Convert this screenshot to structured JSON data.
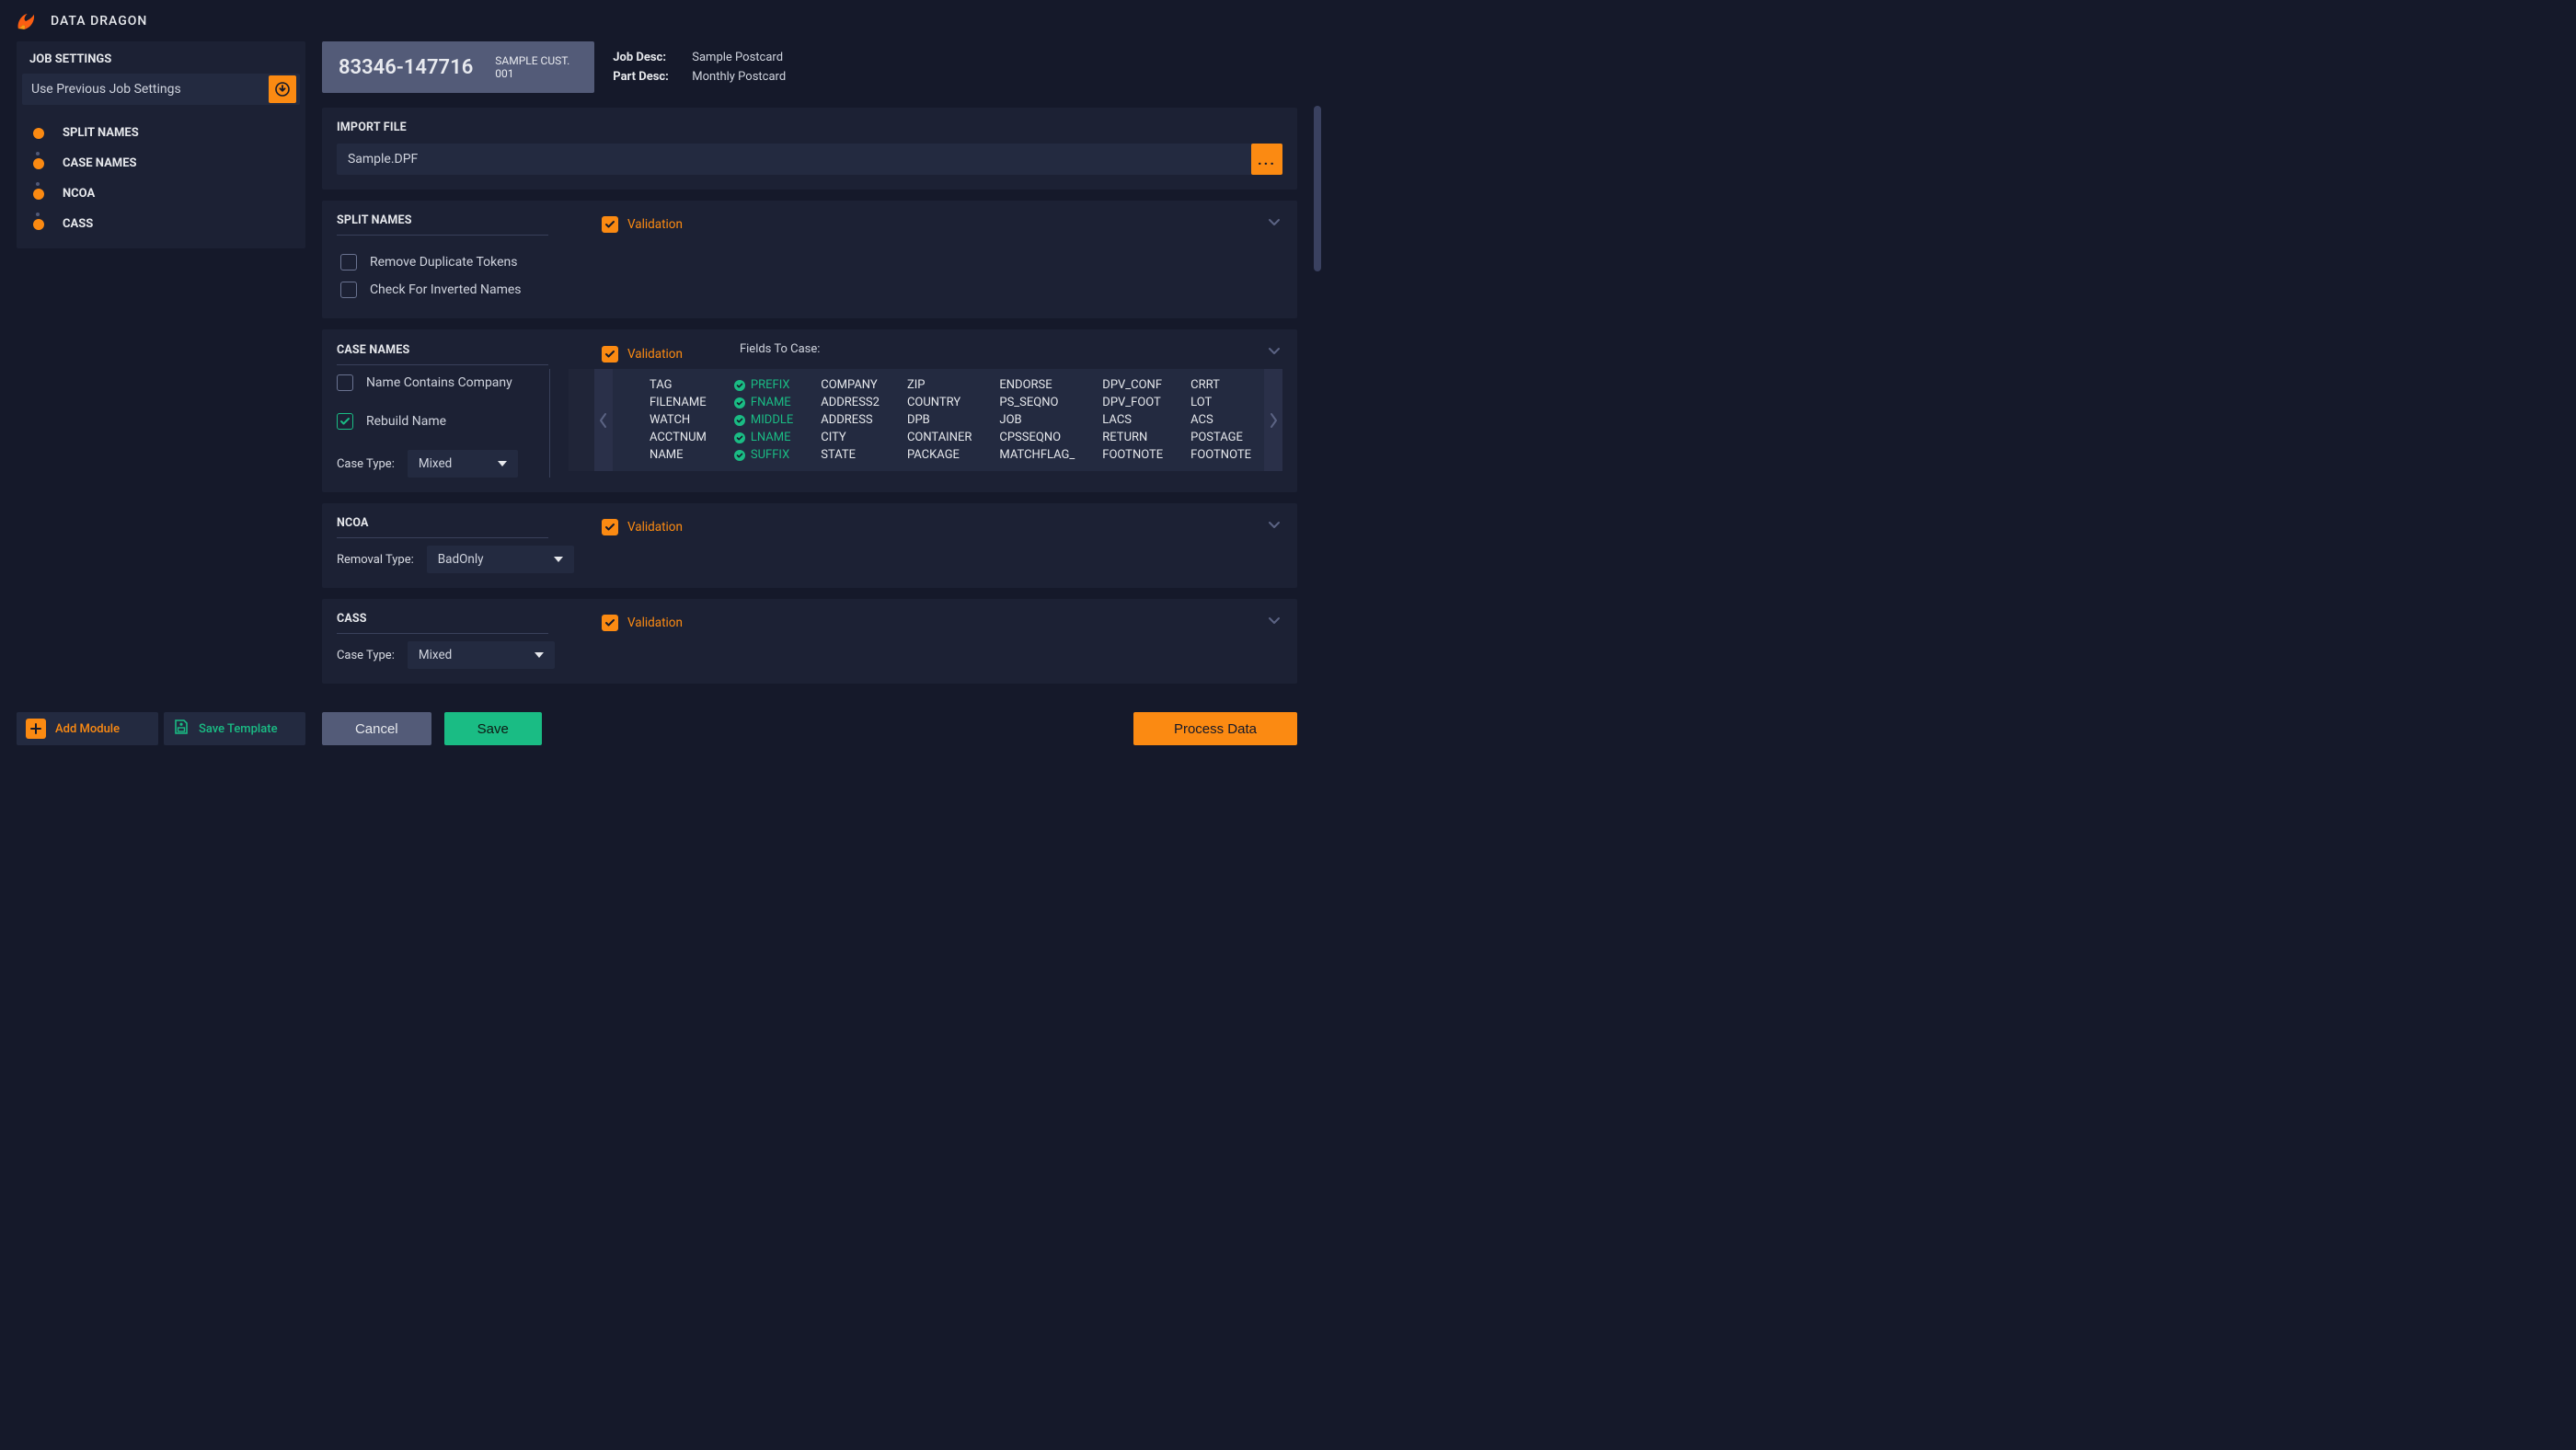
{
  "app": {
    "title": "DATA DRAGON"
  },
  "sidebar": {
    "header": "JOB SETTINGS",
    "prev_settings_label": "Use Previous Job Settings",
    "modules": [
      {
        "label": "SPLIT NAMES"
      },
      {
        "label": "CASE NAMES"
      },
      {
        "label": "NCOA"
      },
      {
        "label": "CASS"
      }
    ],
    "add_module_label": "Add Module",
    "save_template_label": "Save Template"
  },
  "job": {
    "id": "83346-147716",
    "customer": "SAMPLE CUST. 001",
    "desc_key": "Job Desc:",
    "desc_val": "Sample Postcard",
    "part_key": "Part Desc:",
    "part_val": "Monthly Postcard"
  },
  "import": {
    "title": "IMPORT FILE",
    "filename": "Sample.DPF",
    "browse_label": "..."
  },
  "split_names": {
    "title": "SPLIT NAMES",
    "validation_label": "Validation",
    "remove_dup_label": "Remove Duplicate Tokens",
    "check_inverted_label": "Check For Inverted Names"
  },
  "case_names": {
    "title": "CASE NAMES",
    "validation_label": "Validation",
    "contains_company_label": "Name Contains Company",
    "rebuild_name_label": "Rebuild Name",
    "case_type_key": "Case Type:",
    "case_type_val": "Mixed",
    "fields_label": "Fields To Case:",
    "columns": [
      [
        "TAG",
        "FILENAME",
        "WATCH",
        "ACCTNUM",
        "NAME"
      ],
      [
        "PREFIX",
        "FNAME",
        "MIDDLE",
        "LNAME",
        "SUFFIX"
      ],
      [
        "COMPANY",
        "ADDRESS2",
        "ADDRESS",
        "CITY",
        "STATE"
      ],
      [
        "ZIP",
        "COUNTRY",
        "DPB",
        "CONTAINER",
        "PACKAGE"
      ],
      [
        "ENDORSE",
        "PS_SEQNO",
        "JOB",
        "CPSSEQNO",
        "MATCHFLAG_"
      ],
      [
        "DPV_CONF",
        "DPV_FOOT",
        "LACS",
        "RETURN",
        "FOOTNOTE"
      ],
      [
        "CRRT",
        "LOT",
        "ACS",
        "POSTAGE",
        "FOOTNOTE"
      ]
    ],
    "selected_col_index": 1
  },
  "ncoa": {
    "title": "NCOA",
    "validation_label": "Validation",
    "removal_type_key": "Removal Type:",
    "removal_type_val": "BadOnly"
  },
  "cass": {
    "title": "CASS",
    "validation_label": "Validation",
    "case_type_key": "Case Type:",
    "case_type_val": "Mixed"
  },
  "footer": {
    "cancel": "Cancel",
    "save": "Save",
    "process": "Process Data"
  }
}
